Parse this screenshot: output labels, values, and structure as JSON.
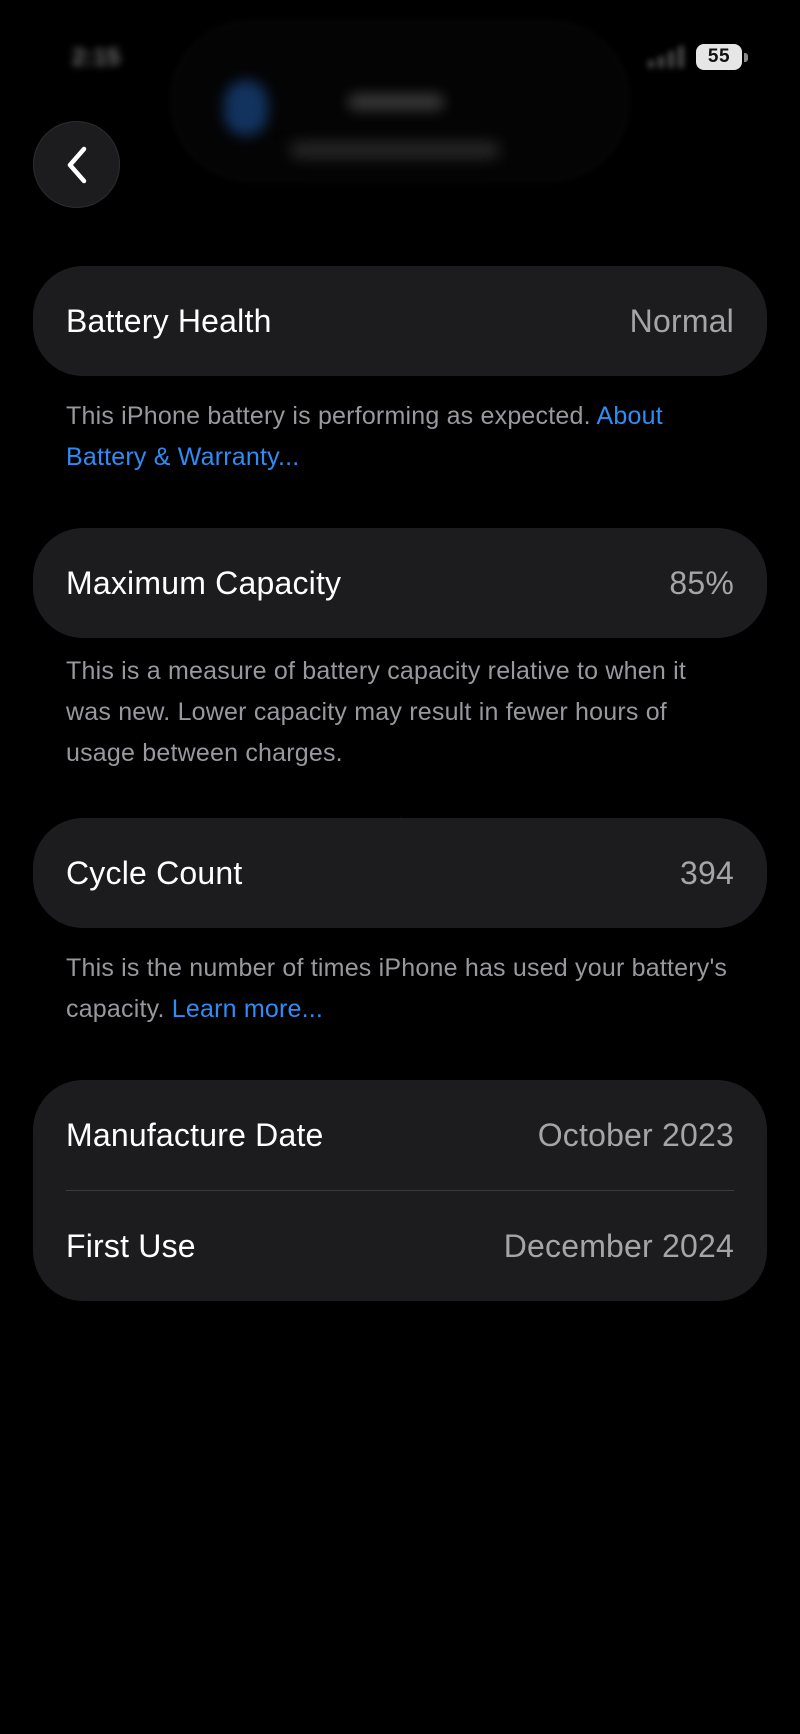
{
  "status_bar": {
    "time": "2:15",
    "battery_level": "55"
  },
  "battery_health": {
    "label": "Battery Health",
    "value": "Normal",
    "description": "This iPhone battery is performing as expected.",
    "link": "About Battery & Warranty..."
  },
  "maximum_capacity": {
    "label": "Maximum Capacity",
    "value": "85%",
    "description": "This is a measure of battery capacity relative to when it was new. Lower capacity may result in fewer hours of usage between charges."
  },
  "cycle_count": {
    "label": "Cycle Count",
    "value": "394",
    "description": "This is the number of times iPhone has used your battery's capacity.",
    "link": "Learn more..."
  },
  "dates": {
    "manufacture_label": "Manufacture Date",
    "manufacture_value": "October 2023",
    "first_use_label": "First Use",
    "first_use_value": "December 2024"
  },
  "colors": {
    "background": "#000000",
    "card": "#1c1c1e",
    "link": "#2f8cf6",
    "secondary_text": "#98989e"
  },
  "icons": {
    "back": "chevron-left-icon",
    "battery": "battery-icon",
    "signal": "signal-icon"
  }
}
